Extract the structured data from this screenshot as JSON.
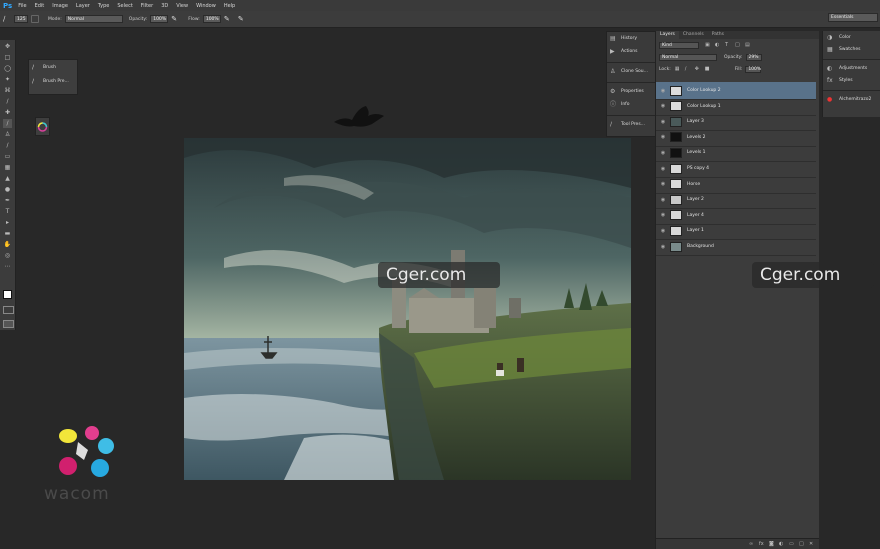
{
  "app": {
    "logo": "Ps"
  },
  "menu": [
    "File",
    "Edit",
    "Image",
    "Layer",
    "Type",
    "Select",
    "Filter",
    "3D",
    "View",
    "Window",
    "Help"
  ],
  "options_bar": {
    "brush_size": "125",
    "mode_label": "Mode:",
    "mode_value": "Normal",
    "opacity_label": "Opacity:",
    "opacity_value": "100%",
    "flow_label": "Flow:",
    "flow_value": "100%",
    "workspace": "Essentials"
  },
  "brush_panel": {
    "items": [
      {
        "label": "Brush",
        "icon": "brush-icon"
      },
      {
        "label": "Brush Pre...",
        "icon": "brush-presets-icon"
      }
    ]
  },
  "collapsed_panels": {
    "items": [
      {
        "label": "History",
        "icon": "history-icon"
      },
      {
        "label": "Actions",
        "icon": "actions-icon"
      },
      {
        "label": "Clone Sou...",
        "icon": "clone-source-icon"
      },
      {
        "label": "Properties",
        "icon": "properties-icon"
      },
      {
        "label": "Info",
        "icon": "info-icon"
      },
      {
        "label": "Tool Pres...",
        "icon": "tool-presets-icon"
      }
    ]
  },
  "layers_panel": {
    "tabs": [
      "Layers",
      "Channels",
      "Paths"
    ],
    "filter_kind": "Kind",
    "blend_mode": "Normal",
    "opacity_label": "Opacity:",
    "opacity_value": "29%",
    "lock_label": "Lock:",
    "fill_label": "Fill:",
    "fill_value": "100%",
    "layers": [
      {
        "name": "Color Lookup 2",
        "selected": true,
        "thumb": "#dcdcdc"
      },
      {
        "name": "Color Lookup 1",
        "selected": false,
        "thumb": "#dcdcdc"
      },
      {
        "name": "Layer 3",
        "selected": false,
        "thumb": "#4a5a5a"
      },
      {
        "name": "Levels 2",
        "selected": false,
        "thumb": "#111111"
      },
      {
        "name": "Levels 1",
        "selected": false,
        "thumb": "#111111"
      },
      {
        "name": "PS copy 4",
        "selected": false,
        "thumb": "#d8d8d8"
      },
      {
        "name": "Horse",
        "selected": false,
        "thumb": "#d8d8d8"
      },
      {
        "name": "Layer 2",
        "selected": false,
        "thumb": "#c8c8c8"
      },
      {
        "name": "Layer 4",
        "selected": false,
        "thumb": "#d8d8d8"
      },
      {
        "name": "Layer 1",
        "selected": false,
        "thumb": "#d8d8d8"
      },
      {
        "name": "Background",
        "selected": false,
        "thumb": "#7a8c8c"
      }
    ]
  },
  "right_dock": {
    "items": [
      {
        "label": "Color",
        "icon": "color-icon"
      },
      {
        "label": "Swatches",
        "icon": "swatches-icon"
      },
      {
        "label": "Adjustments",
        "icon": "adjustments-icon"
      },
      {
        "label": "Styles",
        "icon": "styles-icon"
      },
      {
        "label": "Alchemitrazo2",
        "icon": "alchemi-icon"
      }
    ]
  },
  "watermarks": [
    "Cger.com",
    "Cger.com"
  ],
  "wacom": {
    "text": "wacom"
  },
  "colors": {
    "accent": "#31a8ff",
    "selected_layer": "#59728a"
  }
}
